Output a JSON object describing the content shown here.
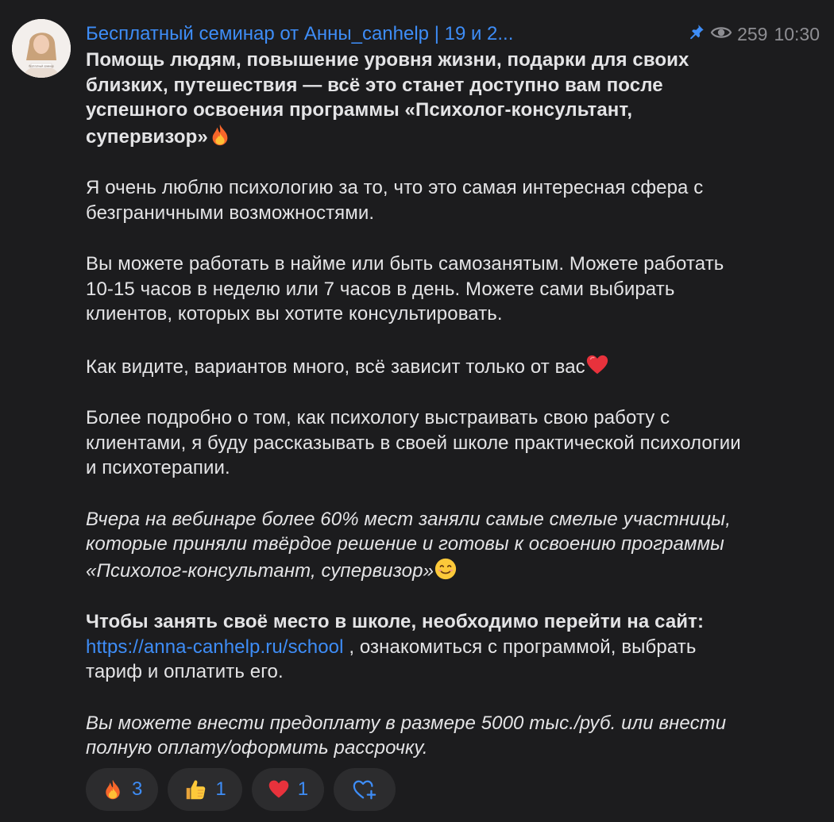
{
  "channel": {
    "title": "Бесплатный семинар от Анны_canhelp | 19 и 2...",
    "views": "259",
    "time": "10:30",
    "avatar_caption": "бесплатный семинар"
  },
  "post": {
    "p1": "Помощь людям, повышение уровня жизни, подарки для своих близких, путешествия — всё это станет доступно вам после успешного освоения программы «Психолог-консультант, супервизор»",
    "p2": "Я очень люблю психологию за то, что это самая интересная сфера с безграничными возможностями.",
    "p3": "Вы можете работать в найме или быть самозанятым. Можете работать 10-15 часов в неделю или 7 часов в день. Можете сами выбирать клиентов, которых вы хотите консультировать.",
    "p4": "Как видите, вариантов много, всё зависит только от вас",
    "p5": "Более подробно о том, как психологу выстраивать свою работу с клиентами, я буду рассказывать в своей школе практической психологии и психотерапии.",
    "p6": "Вчера на вебинаре более 60% мест заняли самые смелые участницы, которые приняли твёрдое решение и готовы к освоению программы «Психолог-консультант, супервизор»",
    "p7_bold": "Чтобы занять своё место в школе, необходимо перейти на сайт:",
    "p7_link": "https://anna-canhelp.ru/school",
    "p7_rest": ", ознакомиться с программой, выбрать тариф и оплатить его.",
    "p8": "Вы можете внести предоплату в размере 5000 тыс./руб. или внести полную оплату/оформить рассрочку."
  },
  "reactions": [
    {
      "icon": "fire-emoji",
      "count": "3"
    },
    {
      "icon": "thumbs-up-emoji",
      "count": "1"
    },
    {
      "icon": "red-heart-emoji",
      "count": "1"
    },
    {
      "icon": "add-reaction-icon",
      "count": ""
    }
  ],
  "colors": {
    "background": "#1c1c1e",
    "text": "#e4e4e6",
    "accent": "#3e8df7",
    "muted": "#8e8e93",
    "reaction_bg": "#2c2c2e"
  }
}
